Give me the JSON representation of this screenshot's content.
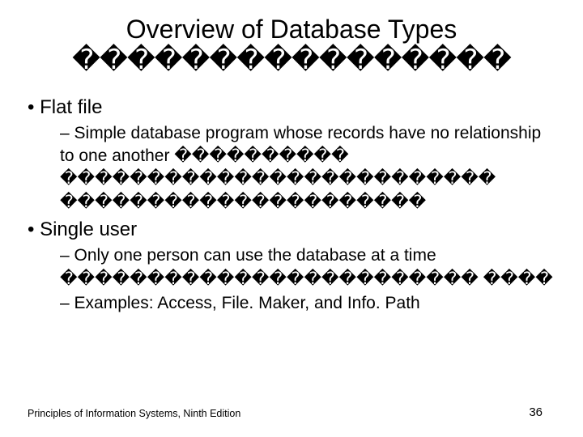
{
  "title": "Overview of Database Types",
  "title_glyphs": "����������������",
  "bullets": [
    {
      "level": 1,
      "style": "dot",
      "text": "Flat file"
    },
    {
      "level": 2,
      "style": "dash",
      "text": "Simple database program whose records have no relationship to one another ���������� ������������������������� ���������������������"
    },
    {
      "level": 1,
      "style": "dot",
      "text": "Single user"
    },
    {
      "level": 2,
      "style": "dash",
      "text": "Only one person can use the database at a time ������������������������ ����"
    },
    {
      "level": 2,
      "style": "dash",
      "text": "Examples: Access, File. Maker, and Info. Path"
    }
  ],
  "footer": "Principles of Information Systems, Ninth Edition",
  "page_number": "36"
}
